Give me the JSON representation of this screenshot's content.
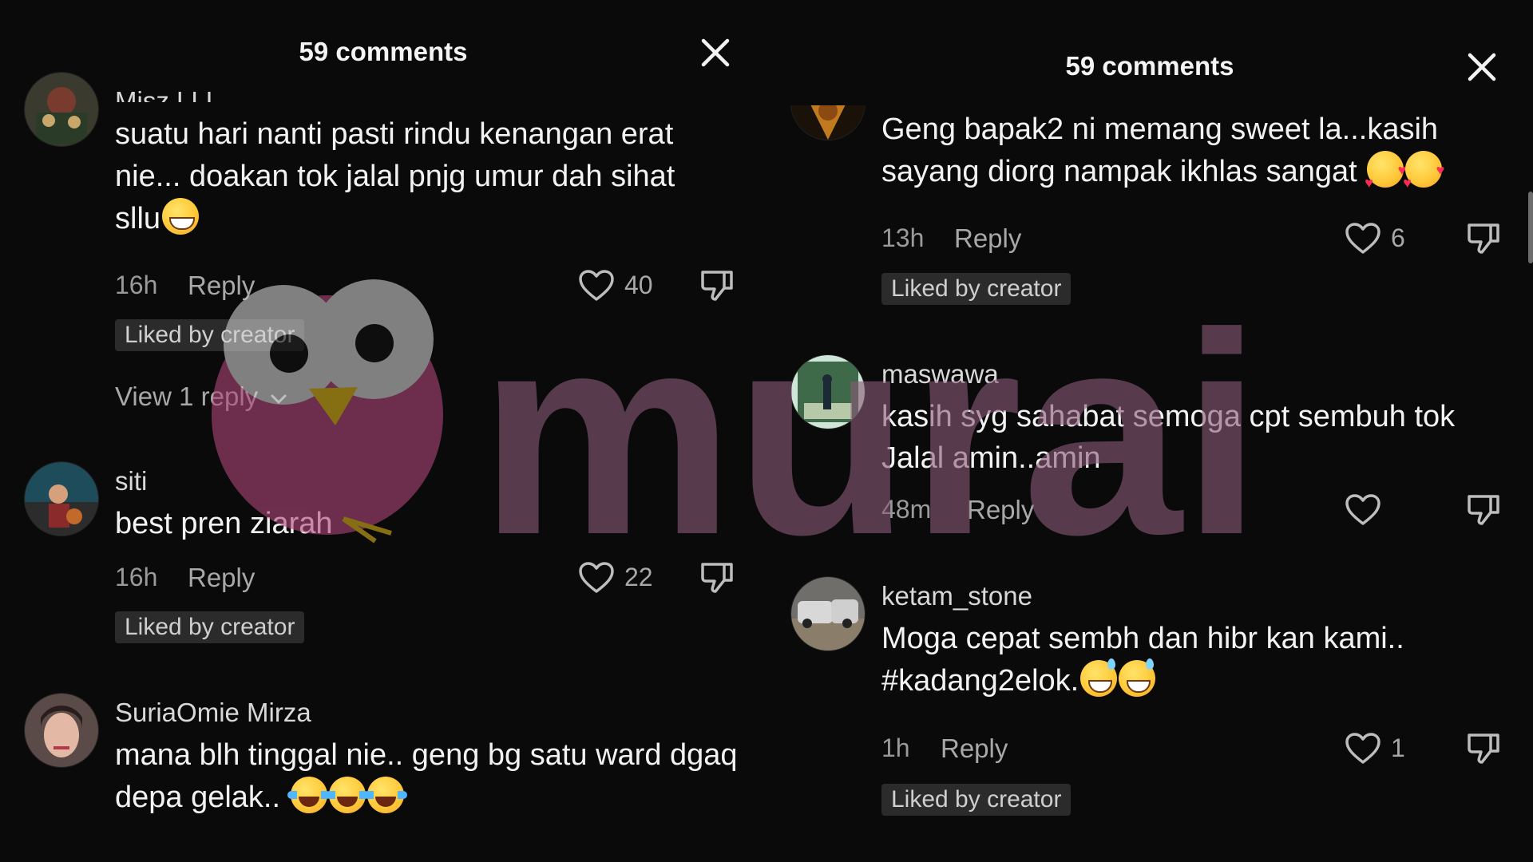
{
  "left_panel": {
    "title": "59 comments",
    "partial_username": "Misz LLL",
    "comments": [
      {
        "username": "",
        "text": "suatu hari nanti pasti rindu kenangan erat nie... doakan tok jalal pnjg umur dah sihat sllu",
        "emojis": [
          "grinning-face"
        ],
        "time": "16h",
        "reply_label": "Reply",
        "like_count": "40",
        "liked_by_creator": "Liked by creator",
        "view_replies": "View 1 reply"
      },
      {
        "username": "siti",
        "text": "best pren ziarah",
        "time": "16h",
        "reply_label": "Reply",
        "like_count": "22",
        "liked_by_creator": "Liked by creator"
      },
      {
        "username": "SuriaOmie Mirza",
        "text": "mana blh tinggal nie.. geng bg satu ward dgaq depa gelak..",
        "emojis": [
          "tears-of-joy",
          "tears-of-joy",
          "tears-of-joy"
        ]
      }
    ]
  },
  "right_panel": {
    "title": "59 comments",
    "comments": [
      {
        "text": "Geng bapak2 ni memang sweet la...kasih sayang diorg nampak ikhlas sangat",
        "emojis": [
          "smiling-face-with-hearts",
          "smiling-face-with-hearts"
        ],
        "time": "13h",
        "reply_label": "Reply",
        "like_count": "6",
        "liked_by_creator": "Liked by creator"
      },
      {
        "username": "maswawa",
        "text": "kasih syg sahabat semoga cpt sembuh tok Jalal amin..amin",
        "time": "48m",
        "reply_label": "Reply",
        "like_count": ""
      },
      {
        "username": "ketam_stone",
        "text": "Moga cepat sembh dan hibr kan kami.. #kadang2elok.",
        "emojis": [
          "grinning-face-with-sweat",
          "grinning-face-with-sweat"
        ],
        "time": "1h",
        "reply_label": "Reply",
        "like_count": "1",
        "liked_by_creator": "Liked by creator"
      }
    ]
  },
  "watermark": {
    "text": "murai",
    "colors": {
      "brand": "#8a5a78",
      "owl_body": "#b0467a",
      "owl_eye": "#d9d9d9",
      "owl_beak": "#d9b21a"
    }
  },
  "icons": [
    "close-icon",
    "heart-icon",
    "thumbs-down-icon",
    "chevron-down-icon"
  ]
}
